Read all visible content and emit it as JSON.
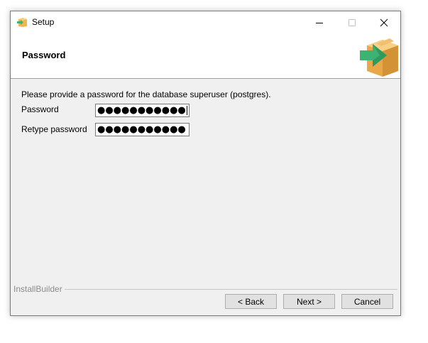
{
  "window": {
    "title": "Setup",
    "app_icon": "installer-box-icon",
    "controls": {
      "minimize": "minimize-icon",
      "maximize": "maximize-icon",
      "close": "close-icon"
    }
  },
  "header": {
    "title": "Password",
    "logo": "installer-box-arrow-icon"
  },
  "form": {
    "intro": "Please provide a password for the database superuser (postgres).",
    "password_label": "Password",
    "password_value": "●●●●●●●●●●●",
    "retype_label": "Retype password",
    "retype_value": "●●●●●●●●●●●"
  },
  "footer": {
    "brand": "InstallBuilder",
    "back_label": "< Back",
    "next_label": "Next >",
    "cancel_label": "Cancel"
  },
  "colors": {
    "arrow_green": "#3cb371",
    "box_tan": "#f0b450"
  }
}
